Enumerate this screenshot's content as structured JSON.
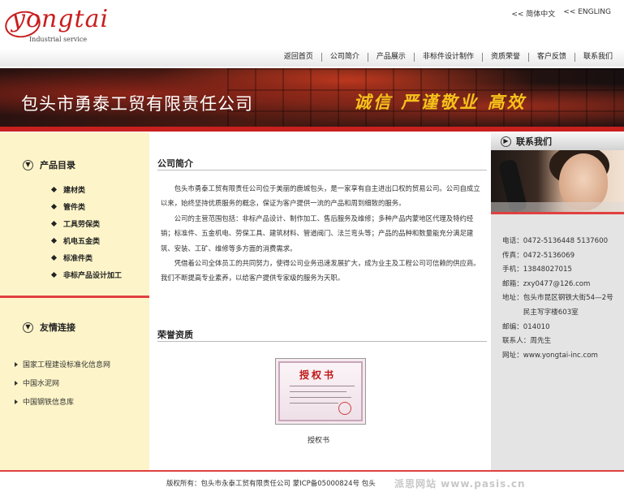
{
  "logo": {
    "word": "yongtai",
    "subtitle": "Industrial service"
  },
  "lang": {
    "simplified": "<< 简体中文",
    "english": "<< ENGLING"
  },
  "nav": [
    "返回首页",
    "公司简介",
    "产品展示",
    "非标件设计制作",
    "资质荣誉",
    "客户反馈",
    "联系我们"
  ],
  "banner": {
    "company": "包头市勇泰工贸有限责任公司",
    "slogan": "诚信 严谨敬业 高效"
  },
  "left": {
    "catalog_title": "产品目录",
    "categories": [
      "建材类",
      "管件类",
      "工具劳保类",
      "机电五金类",
      "标准件类",
      "非标产品设计加工"
    ],
    "links_title": "友情连接",
    "links": [
      "国家工程建设标准化信息网",
      "中国水泥网",
      "中国钢铁信息库"
    ]
  },
  "main": {
    "about_title": "公司简介",
    "about_paragraphs": [
      "包头市勇泰工贸有限责任公司位于美丽的鹿城包头，是一家享有自主进出口权的贸易公司。公司自成立以来，始终坚持优质服务的概念，保证为客户提供一流的产品和周到细致的服务。",
      "公司的主营范围包括：非标产品设计、制作加工、售后服务及维修；多种产品内蒙地区代理及特约经销；标准件、五金机电、劳保工具、建筑材料、管道阀门、法兰弯头等；产品的品种和数量能充分满足建筑、安装、工矿、维修等多方面的消费需求。",
      "凭借着公司全体员工的共同努力，使得公司业务迅速发展扩大，成为业主及工程公司可信赖的供应商。我们不断提高专业素养，以给客户提供专家级的服务为天职。"
    ],
    "honor_title": "荣誉资质",
    "cert_stamp": "授权书",
    "cert_caption": "授权书"
  },
  "right": {
    "title": "联系我们",
    "contacts": [
      {
        "label": "电话：",
        "value": "0472-5136448 5137600"
      },
      {
        "label": "传真：",
        "value": "0472-5136069"
      },
      {
        "label": "手机：",
        "value": "13848027015"
      },
      {
        "label": "邮箱：",
        "value": "zxy0477@126.com"
      },
      {
        "label": "地址：",
        "value": "包头市昆区钢铁大街54—2号民主写字楼603室"
      },
      {
        "label": "邮编：",
        "value": "014010"
      },
      {
        "label": "联系人：",
        "value": "周先生"
      },
      {
        "label": "网址：",
        "value": "www.yongtai-inc.com"
      }
    ]
  },
  "footer": {
    "copyright": "版权所有：包头市永泰工贸有限责任公司 蒙ICP备05000824号 包头",
    "watermark": "派思网站 www.pasis.cn"
  },
  "colors": {
    "accent_red": "#e04040",
    "brand_red": "#c81e1e",
    "slogan_gold": "#f5c21a",
    "left_bg": "#fdf5c9",
    "right_bg": "#e4e4e4"
  }
}
